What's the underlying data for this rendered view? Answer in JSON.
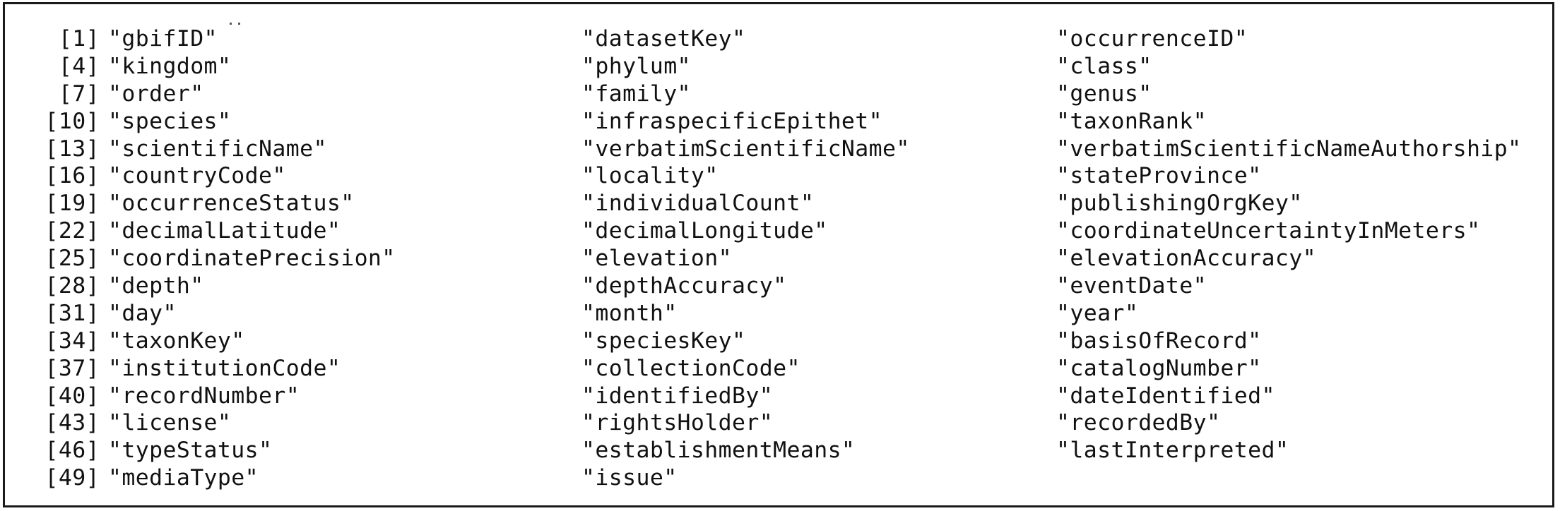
{
  "console": {
    "rows": [
      {
        "index": "[1]",
        "values": [
          "\"gbifID\"",
          "\"datasetKey\"",
          "\"occurrenceID\""
        ]
      },
      {
        "index": "[4]",
        "values": [
          "\"kingdom\"",
          "\"phylum\"",
          "\"class\""
        ]
      },
      {
        "index": "[7]",
        "values": [
          "\"order\"",
          "\"family\"",
          "\"genus\""
        ]
      },
      {
        "index": "[10]",
        "values": [
          "\"species\"",
          "\"infraspecificEpithet\"",
          "\"taxonRank\""
        ]
      },
      {
        "index": "[13]",
        "values": [
          "\"scientificName\"",
          "\"verbatimScientificName\"",
          "\"verbatimScientificNameAuthorship\""
        ]
      },
      {
        "index": "[16]",
        "values": [
          "\"countryCode\"",
          "\"locality\"",
          "\"stateProvince\""
        ]
      },
      {
        "index": "[19]",
        "values": [
          "\"occurrenceStatus\"",
          "\"individualCount\"",
          "\"publishingOrgKey\""
        ]
      },
      {
        "index": "[22]",
        "values": [
          "\"decimalLatitude\"",
          "\"decimalLongitude\"",
          "\"coordinateUncertaintyInMeters\""
        ]
      },
      {
        "index": "[25]",
        "values": [
          "\"coordinatePrecision\"",
          "\"elevation\"",
          "\"elevationAccuracy\""
        ]
      },
      {
        "index": "[28]",
        "values": [
          "\"depth\"",
          "\"depthAccuracy\"",
          "\"eventDate\""
        ]
      },
      {
        "index": "[31]",
        "values": [
          "\"day\"",
          "\"month\"",
          "\"year\""
        ]
      },
      {
        "index": "[34]",
        "values": [
          "\"taxonKey\"",
          "\"speciesKey\"",
          "\"basisOfRecord\""
        ]
      },
      {
        "index": "[37]",
        "values": [
          "\"institutionCode\"",
          "\"collectionCode\"",
          "\"catalogNumber\""
        ]
      },
      {
        "index": "[40]",
        "values": [
          "\"recordNumber\"",
          "\"identifiedBy\"",
          "\"dateIdentified\""
        ]
      },
      {
        "index": "[43]",
        "values": [
          "\"license\"",
          "\"rightsHolder\"",
          "\"recordedBy\""
        ]
      },
      {
        "index": "[46]",
        "values": [
          "\"typeStatus\"",
          "\"establishmentMeans\"",
          "\"lastInterpreted\""
        ]
      },
      {
        "index": "[49]",
        "values": [
          "\"mediaType\"",
          "\"issue\""
        ]
      }
    ]
  }
}
